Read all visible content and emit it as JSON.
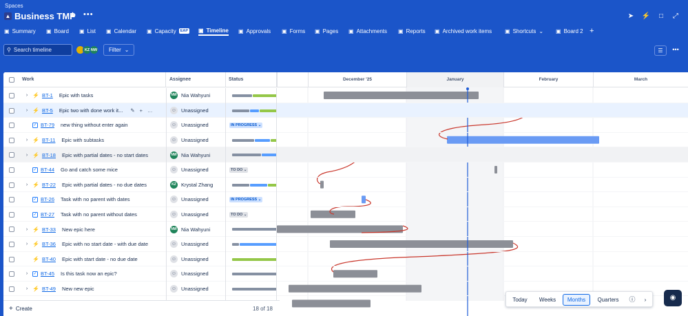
{
  "header": {
    "spaces_label": "Spaces",
    "project_icon": "rocket-icon",
    "project_title": "Business TMP"
  },
  "nav": [
    {
      "label": "Summary",
      "icon": "globe-icon"
    },
    {
      "label": "Board",
      "icon": "board-icon"
    },
    {
      "label": "List",
      "icon": "list-icon"
    },
    {
      "label": "Calendar",
      "icon": "calendar-icon"
    },
    {
      "label": "Capacity",
      "icon": "gauge-icon",
      "badge": "EAP"
    },
    {
      "label": "Timeline",
      "icon": "timeline-icon",
      "active": true
    },
    {
      "label": "Approvals",
      "icon": "approvals-icon"
    },
    {
      "label": "Forms",
      "icon": "forms-icon"
    },
    {
      "label": "Pages",
      "icon": "pages-icon"
    },
    {
      "label": "Attachments",
      "icon": "paperclip-icon"
    },
    {
      "label": "Reports",
      "icon": "chart-icon"
    },
    {
      "label": "Archived work items",
      "icon": "archive-icon"
    },
    {
      "label": "Shortcuts",
      "icon": "link-icon"
    },
    {
      "label": "Board 2",
      "icon": "board-icon"
    }
  ],
  "toolbar": {
    "search_placeholder": "Search timeline",
    "filter_label": "Filter",
    "avatars": [
      {
        "initials": "",
        "color": "#e2b203"
      },
      {
        "initials": "KZ",
        "color": "#1f845a"
      },
      {
        "initials": "NW",
        "color": "#1f845a"
      }
    ]
  },
  "grid": {
    "col_work": "Work",
    "col_assignee": "Assignee",
    "col_status": "Status",
    "months": [
      "December '25",
      "January",
      "February",
      "March"
    ]
  },
  "rows": [
    {
      "key": "BT-1",
      "summary": "Epic with tasks",
      "type": "epic",
      "expand": true,
      "assignee": "Nia Wahyuni",
      "initials": "NW",
      "status": {
        "kind": "progress",
        "done": 0.45,
        "inprog": 0,
        "todo": 0.55
      }
    },
    {
      "key": "BT-5",
      "summary": "Epic two with done work it...",
      "type": "epic",
      "expand": true,
      "assignee": "Unassigned",
      "status": {
        "kind": "progress",
        "done": 0.4,
        "inprog": 0.2,
        "todo": 0.4
      },
      "highlight": true
    },
    {
      "key": "BT-79",
      "summary": "new thing without enter again",
      "type": "task",
      "expand": false,
      "assignee": "Unassigned",
      "status": {
        "kind": "lozenge",
        "label": "IN PROGRESS",
        "style": "ip"
      }
    },
    {
      "key": "BT-11",
      "summary": "Epic with subtasks",
      "type": "epic",
      "expand": true,
      "assignee": "Unassigned",
      "status": {
        "kind": "progress",
        "done": 0.5,
        "inprog": 0.35,
        "todo": 0.15
      }
    },
    {
      "key": "BT-18",
      "summary": "Epic with partial dates - no start dates",
      "type": "epic",
      "expand": true,
      "assignee": "Nia Wahyuni",
      "initials": "NW",
      "status": {
        "kind": "progress",
        "done": 0.65,
        "inprog": 0.35,
        "todo": 0
      },
      "grey": true
    },
    {
      "key": "BT-44",
      "summary": "Go and catch some mice",
      "type": "task",
      "expand": false,
      "assignee": "Unassigned",
      "status": {
        "kind": "lozenge",
        "label": "TO DO",
        "style": "td"
      }
    },
    {
      "key": "BT-22",
      "summary": "Epic with partial dates - no due dates",
      "type": "epic",
      "expand": true,
      "assignee": "Krystal Zhang",
      "initials": "KZ",
      "status": {
        "kind": "progress",
        "done": 0.4,
        "inprog": 0.4,
        "todo": 0.2
      }
    },
    {
      "key": "BT-26",
      "summary": "Task with no parent with dates",
      "type": "task",
      "expand": false,
      "assignee": "Unassigned",
      "status": {
        "kind": "lozenge",
        "label": "IN PROGRESS",
        "style": "ip"
      }
    },
    {
      "key": "BT-27",
      "summary": "Task with no parent without dates",
      "type": "task",
      "expand": false,
      "assignee": "Unassigned",
      "status": {
        "kind": "lozenge",
        "label": "TO DO",
        "style": "td"
      }
    },
    {
      "key": "BT-33",
      "summary": "New epic here",
      "type": "epic",
      "expand": true,
      "assignee": "Nia Wahyuni",
      "initials": "NW",
      "status": {
        "kind": "progress",
        "done": 1,
        "inprog": 0,
        "todo": 0
      }
    },
    {
      "key": "BT-36",
      "summary": "Epic with no start date - with due date",
      "type": "epic",
      "expand": true,
      "assignee": "Unassigned",
      "status": {
        "kind": "progress",
        "done": 0.15,
        "inprog": 0.85,
        "todo": 0
      }
    },
    {
      "key": "BT-40",
      "summary": "Epic with start date - no due date",
      "type": "epic",
      "expand": false,
      "assignee": "Unassigned",
      "status": {
        "kind": "progress",
        "done": 0,
        "inprog": 0,
        "todo": 1
      }
    },
    {
      "key": "BT-45",
      "summary": "Is this task now an epic?",
      "type": "task",
      "expand": true,
      "assignee": "Unassigned",
      "status": {
        "kind": "progress",
        "done": 1,
        "inprog": 0,
        "todo": 0
      }
    },
    {
      "key": "BT-49",
      "summary": "New new epic",
      "type": "epic",
      "expand": true,
      "assignee": "Unassigned",
      "status": {
        "kind": "progress",
        "done": 1,
        "inprog": 0,
        "todo": 0
      }
    }
  ],
  "footer": {
    "create_label": "Create",
    "row_count": "18 of 18"
  },
  "zoom": {
    "today": "Today",
    "options": [
      "Weeks",
      "Months",
      "Quarters"
    ],
    "selected": "Months"
  },
  "colors": {
    "brand": "#1b55c9",
    "done": "#8590a2",
    "inprog": "#579dff",
    "todo": "#94c748",
    "bar_grey": "#8c8f97",
    "bar_blue": "#6a9bf4",
    "dependency": "#c9372c",
    "today_line": "#1d5bd6"
  }
}
